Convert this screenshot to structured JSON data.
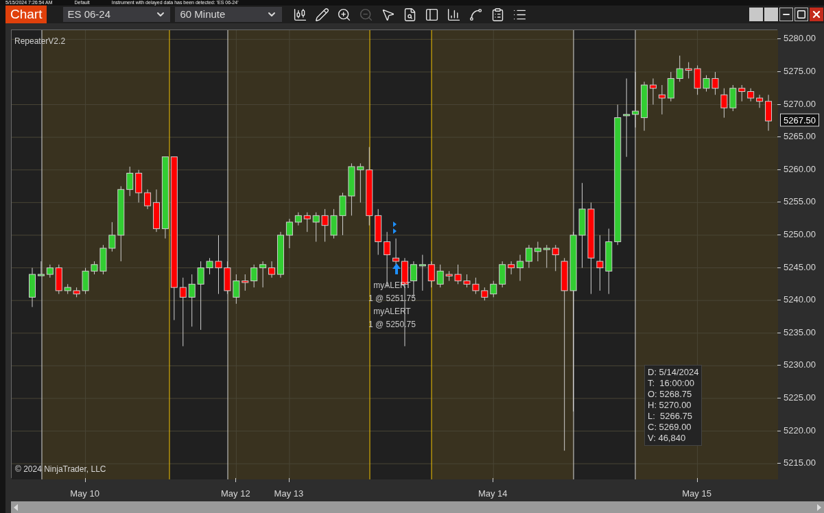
{
  "background_strip": {
    "texts": [
      "5/15/2024 7:26:54 AM",
      "Default",
      "Instrument with delayed data has been detected: 'ES 06-24'"
    ]
  },
  "window": {
    "title": "Chart",
    "instrument": "ES 06-24",
    "interval": "60 Minute"
  },
  "toolbar": [
    {
      "kind": "bars",
      "disabled": false
    },
    {
      "kind": "draw",
      "disabled": false
    },
    {
      "kind": "zoom-in",
      "disabled": false
    },
    {
      "kind": "zoom-out",
      "disabled": true
    },
    {
      "kind": "pointer",
      "disabled": false
    },
    {
      "kind": "data-box",
      "disabled": false
    },
    {
      "kind": "chart-trader",
      "disabled": false
    },
    {
      "kind": "indicators",
      "disabled": false
    },
    {
      "kind": "strategies",
      "disabled": false
    },
    {
      "kind": "analyzer",
      "disabled": false
    },
    {
      "kind": "properties",
      "disabled": false
    }
  ],
  "chart": {
    "indicator_label": "RepeaterV2.2",
    "copyright": "© 2024 NinjaTrader, LLC",
    "alerts": [
      {
        "name": "myALERT",
        "fill": "1 @ 5251.75"
      },
      {
        "name": "myALERT",
        "fill": "1 @ 5250.75"
      }
    ],
    "chart_data": {
      "type": "candlestick",
      "categories": [
        null,
        null,
        null,
        null,
        null,
        null,
        "May 10",
        null,
        null,
        null,
        null,
        null,
        null,
        null,
        null,
        null,
        null,
        null,
        null,
        null,
        null,
        null,
        null,
        "May 12",
        null,
        null,
        null,
        null,
        null,
        "May 13",
        null,
        null,
        null,
        null,
        null,
        null,
        null,
        null,
        null,
        null,
        null,
        null,
        null,
        null,
        null,
        null,
        null,
        null,
        null,
        null,
        null,
        null,
        "May 14",
        null,
        null,
        null,
        null,
        null,
        null,
        null,
        null,
        null,
        null,
        null,
        null,
        null,
        null,
        null,
        null,
        null,
        null,
        null,
        null,
        null,
        null,
        "May 15",
        null,
        null,
        null,
        null,
        null,
        null,
        null,
        null
      ],
      "ohlc": [
        [
          5240.5,
          5245,
          5239,
          5244
        ],
        [
          5244,
          5246,
          5244,
          5244
        ],
        [
          5244,
          5245.5,
          5243.5,
          5245
        ],
        [
          5245,
          5245.5,
          5241,
          5241.5
        ],
        [
          5241.5,
          5242.5,
          5241,
          5242
        ],
        [
          5241.5,
          5242,
          5240.5,
          5241
        ],
        [
          5241.5,
          5245,
          5241,
          5244.5
        ],
        [
          5244.5,
          5246,
          5244,
          5245.5
        ],
        [
          5244.5,
          5248.5,
          5244,
          5248
        ],
        [
          5248,
          5252,
          5247.5,
          5250
        ],
        [
          5250,
          5257.5,
          5246,
          5257
        ],
        [
          5257,
          5260.5,
          5256,
          5259.5
        ],
        [
          5259.5,
          5260,
          5255,
          5256.5
        ],
        [
          5256.5,
          5257,
          5254,
          5254.5
        ],
        [
          5255,
          5257,
          5250.5,
          5251
        ],
        [
          5251,
          5262,
          5249.5,
          5262
        ],
        [
          5262,
          5262,
          5237,
          5242
        ],
        [
          5242,
          5243.5,
          5233,
          5240.5
        ],
        [
          5240.5,
          5244,
          5236,
          5242.5
        ],
        [
          5242.5,
          5246,
          5235.5,
          5245
        ],
        [
          5245,
          5246.5,
          5244,
          5246
        ],
        [
          5246,
          5250,
          5241,
          5245
        ],
        [
          5245,
          5246,
          5241,
          5241.5
        ],
        [
          5240.5,
          5244,
          5239.5,
          5243
        ],
        [
          5243,
          5244,
          5241.5,
          5242.75
        ],
        [
          5243,
          5245.5,
          5242,
          5245
        ],
        [
          5245,
          5246,
          5242,
          5245.5
        ],
        [
          5245,
          5246,
          5243.5,
          5244
        ],
        [
          5244,
          5250.5,
          5243.5,
          5250
        ],
        [
          5250,
          5252.5,
          5248,
          5252
        ],
        [
          5252,
          5253.5,
          5251.5,
          5253
        ],
        [
          5253,
          5253.5,
          5250.5,
          5252.5
        ],
        [
          5252,
          5253.5,
          5249,
          5253
        ],
        [
          5253,
          5254,
          5249,
          5251.5
        ],
        [
          5250,
          5254,
          5249.5,
          5253
        ],
        [
          5253,
          5256.5,
          5250,
          5256
        ],
        [
          5256,
          5261,
          5253,
          5260.5
        ],
        [
          5260,
          5261,
          5255,
          5260.5
        ],
        [
          5260,
          5263.5,
          5251.5,
          5253
        ],
        [
          5253,
          5254,
          5247,
          5249
        ],
        [
          5249,
          5250.5,
          5242,
          5247
        ],
        [
          5246.5,
          5249.5,
          5245.5,
          5246
        ],
        [
          5246,
          5246.5,
          5233,
          5242.5
        ],
        [
          5243,
          5246,
          5240.5,
          5245.5
        ],
        [
          5245.5,
          5247,
          5241.5,
          5245.5
        ],
        [
          5245.5,
          5246,
          5242,
          5243
        ],
        [
          5242.5,
          5245.5,
          5242,
          5244.5
        ],
        [
          5244,
          5244.5,
          5243,
          5243.75
        ],
        [
          5244,
          5245.5,
          5242.5,
          5243
        ],
        [
          5243,
          5244,
          5242,
          5242.5
        ],
        [
          5242.5,
          5243.5,
          5241,
          5241.5
        ],
        [
          5241.5,
          5242,
          5240,
          5240.5
        ],
        [
          5241,
          5243,
          5240.5,
          5242.5
        ],
        [
          5242.5,
          5246,
          5242,
          5245.5
        ],
        [
          5245.5,
          5246,
          5244,
          5245
        ],
        [
          5245,
          5247,
          5243,
          5246
        ],
        [
          5246,
          5248.5,
          5245,
          5248
        ],
        [
          5247.5,
          5249,
          5246,
          5248
        ],
        [
          5248,
          5248.5,
          5245,
          5248
        ],
        [
          5248,
          5248.5,
          5244.5,
          5247
        ],
        [
          5246,
          5246.5,
          5217,
          5241.5
        ],
        [
          5241.5,
          5250.5,
          5223,
          5250
        ],
        [
          5250,
          5258,
          5245,
          5254
        ],
        [
          5254,
          5255,
          5241,
          5246.5
        ],
        [
          5246,
          5250,
          5241.5,
          5245
        ],
        [
          5244.5,
          5251,
          5241,
          5249
        ],
        [
          5249,
          5270,
          5248.5,
          5268
        ],
        [
          5268.5,
          5274,
          5262,
          5268.5
        ],
        [
          5268.5,
          5275,
          5266.5,
          5269
        ],
        [
          5268,
          5273.5,
          5266,
          5273
        ],
        [
          5273,
          5274,
          5270,
          5272.5
        ],
        [
          5271.5,
          5273,
          5268.5,
          5271
        ],
        [
          5271,
          5275,
          5270.5,
          5274
        ],
        [
          5274,
          5277.5,
          5273.5,
          5275.5
        ],
        [
          5275.5,
          5276.5,
          5274,
          5275.25
        ],
        [
          5275.5,
          5276,
          5271.5,
          5272.5
        ],
        [
          5272.5,
          5274.5,
          5272,
          5274
        ],
        [
          5274,
          5275,
          5271.5,
          5272.5
        ],
        [
          5271.5,
          5272.5,
          5268,
          5269.5
        ],
        [
          5269.5,
          5273,
          5269,
          5272.5
        ],
        [
          5272.5,
          5273,
          5270.5,
          5272
        ],
        [
          5272,
          5272.5,
          5270.5,
          5271
        ],
        [
          5271,
          5271.5,
          5269.5,
          5270.5
        ],
        [
          5270.5,
          5271.5,
          5266,
          5267.5
        ]
      ],
      "ylim": [
        5212.6,
        5281.4
      ],
      "yticks": [
        {
          "value": 5280,
          "label": "5280.00"
        },
        {
          "value": 5275,
          "label": "5275.00"
        },
        {
          "value": 5270,
          "label": "5270.00"
        },
        {
          "value": 5265,
          "label": "5265.00"
        },
        {
          "value": 5260,
          "label": "5260.00"
        },
        {
          "value": 5255,
          "label": "5255.00"
        },
        {
          "value": 5250,
          "label": "5250.00"
        },
        {
          "value": 5245,
          "label": "5245.00"
        },
        {
          "value": 5240,
          "label": "5240.00"
        },
        {
          "value": 5235,
          "label": "5235.00"
        },
        {
          "value": 5230,
          "label": "5230.00"
        },
        {
          "value": 5225,
          "label": "5225.00"
        },
        {
          "value": 5220,
          "label": "5220.00"
        },
        {
          "value": 5215,
          "label": "5215.00"
        }
      ],
      "grid": true
    },
    "last_price": "5267.50",
    "data_box": [
      "D: 5/14/2024",
      "T:  16:00:00",
      "O: 5268.75",
      "H: 5270.00",
      "L:  5266.75",
      "C: 5269.00",
      "V: 46,840"
    ]
  }
}
